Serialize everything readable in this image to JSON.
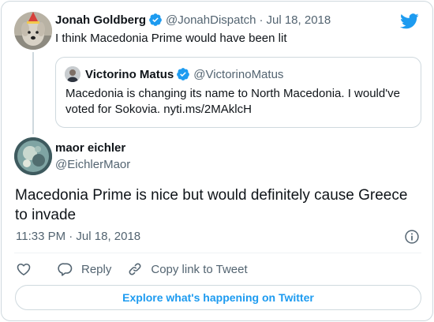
{
  "parent": {
    "name": "Jonah Goldberg",
    "handle": "@JonahDispatch",
    "separator": "·",
    "date": "Jul 18, 2018",
    "text": "I think Macedonia Prime would have been lit"
  },
  "quote": {
    "name": "Victorino Matus",
    "handle": "@VictorinoMatus",
    "text": "Macedonia is changing its name to North Macedonia. I would've voted for Sokovia. nyti.ms/2MAklcH"
  },
  "main": {
    "name": "maor eichler",
    "handle": "@EichlerMaor",
    "text": "Macedonia Prime is nice but would definitely cause Greece to invade",
    "timestamp": "11:33 PM · Jul 18, 2018"
  },
  "actions": {
    "reply": "Reply",
    "copy": "Copy link to Tweet"
  },
  "explore": "Explore what's happening on Twitter",
  "icons": {
    "brand": "twitter-bird-icon",
    "verified": "verified-badge-icon",
    "info": "info-icon",
    "like": "heart-icon",
    "reply": "reply-icon",
    "copy": "link-icon"
  },
  "colors": {
    "accent": "#1d9bf0",
    "text": "#0f1419",
    "secondary": "#536471",
    "border": "#cfd9de"
  }
}
